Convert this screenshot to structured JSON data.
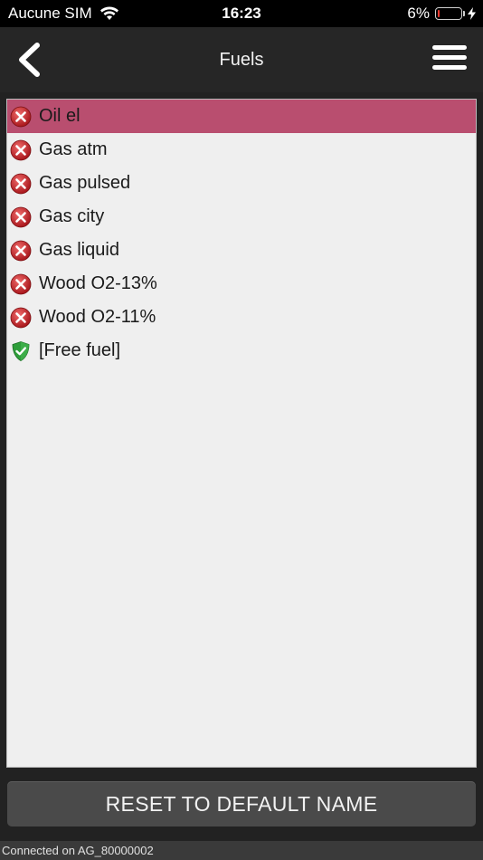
{
  "status_bar": {
    "carrier": "Aucune SIM",
    "time": "16:23",
    "battery_percent": "6%",
    "battery_level": 0.06,
    "icons": [
      "wifi-icon",
      "battery-icon",
      "charging-bolt-icon"
    ]
  },
  "nav": {
    "title": "Fuels",
    "back_icon": "chevron-left-icon",
    "menu_icon": "hamburger-menu-icon"
  },
  "fuels": [
    {
      "label": "Oil el",
      "status": "disabled",
      "icon": "red-x-circle-icon",
      "selected": true
    },
    {
      "label": "Gas atm",
      "status": "disabled",
      "icon": "red-x-circle-icon",
      "selected": false
    },
    {
      "label": "Gas pulsed",
      "status": "disabled",
      "icon": "red-x-circle-icon",
      "selected": false
    },
    {
      "label": "Gas city",
      "status": "disabled",
      "icon": "red-x-circle-icon",
      "selected": false
    },
    {
      "label": "Gas liquid",
      "status": "disabled",
      "icon": "red-x-circle-icon",
      "selected": false
    },
    {
      "label": "Wood O2-13%",
      "status": "disabled",
      "icon": "red-x-circle-icon",
      "selected": false
    },
    {
      "label": "Wood O2-11%",
      "status": "disabled",
      "icon": "red-x-circle-icon",
      "selected": false
    },
    {
      "label": "[Free fuel]",
      "status": "enabled",
      "icon": "green-check-shield-icon",
      "selected": false
    }
  ],
  "reset_button": {
    "label": "RESET TO DEFAULT NAME"
  },
  "connection": {
    "text": "Connected on AG_80000002"
  },
  "colors": {
    "selected_row": "#b94e6f",
    "list_background": "#efefef",
    "nav_background": "#262626",
    "button_background": "#4a4a4a",
    "error_red": "#c8262b",
    "ok_green": "#2e9e3a"
  }
}
